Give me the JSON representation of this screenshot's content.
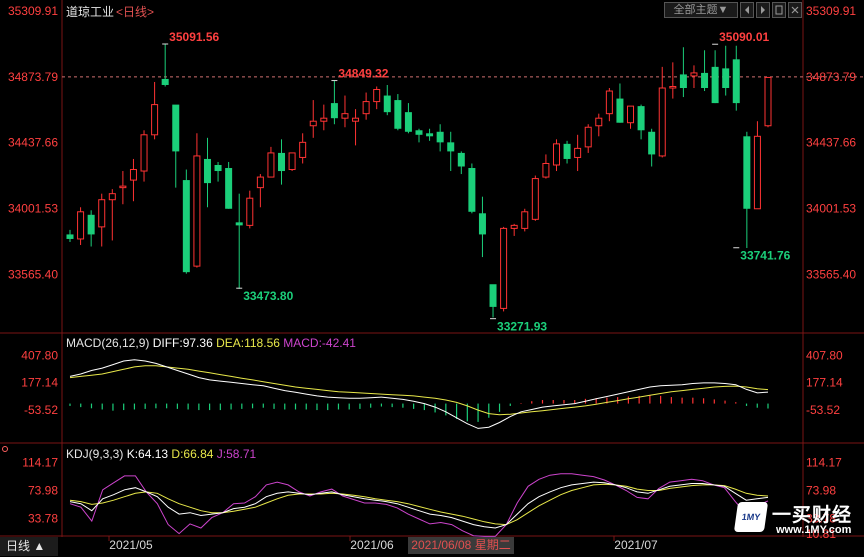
{
  "header": {
    "instrument": "道琼工业",
    "period": "<日线>",
    "theme_button": "全部主题",
    "theme_arrow": "▼"
  },
  "bottom_tab": "日线 ▲",
  "watermark": {
    "mark": "1MY",
    "name": "一买财经",
    "url": "www.1MY.com"
  },
  "colors": {
    "up": "#ff3333",
    "down": "#1bcf7a",
    "axis_red": "#ff4040",
    "diff": "#ffffff",
    "dea": "#e8e84a",
    "j": "#cc44cc",
    "grid": "#7a1515"
  },
  "chart_data": [
    {
      "type": "candlestick",
      "x_ticks": [
        "2021/05",
        "2021/06",
        "2021/07"
      ],
      "cursor_label": "2021/06/08 星期二",
      "y_ticks": [
        35309.91,
        34873.79,
        34437.66,
        34001.53,
        33565.4
      ],
      "ylim": [
        33230,
        35330
      ],
      "price_line": 34873.79,
      "annotations": [
        {
          "label": "35091.56",
          "value": 35091.56
        },
        {
          "label": "34849.32",
          "value": 34849.32
        },
        {
          "label": "33473.80",
          "value": 33473.8
        },
        {
          "label": "33271.93",
          "value": 33271.93
        },
        {
          "label": "35090.01",
          "value": 35090.01
        },
        {
          "label": "33741.76",
          "value": 33741.76
        }
      ],
      "candles": [
        [
          33830,
          33800,
          33860,
          33780
        ],
        [
          33800,
          33980,
          34010,
          33760
        ],
        [
          33960,
          33830,
          33990,
          33750
        ],
        [
          33880,
          34060,
          34100,
          33750
        ],
        [
          34060,
          34100,
          34130,
          33790
        ],
        [
          34140,
          34150,
          34250,
          34030
        ],
        [
          34190,
          34260,
          34330,
          34050
        ],
        [
          34250,
          34490,
          34520,
          34180
        ],
        [
          34490,
          34690,
          34840,
          34460
        ],
        [
          34860,
          34820,
          35090,
          34810
        ],
        [
          34690,
          34380,
          34410,
          34140
        ],
        [
          34190,
          33580,
          34260,
          33570
        ],
        [
          33620,
          34350,
          34500,
          33610
        ],
        [
          34330,
          34170,
          34470,
          34010
        ],
        [
          34290,
          34250,
          34310,
          34180
        ],
        [
          34270,
          34000,
          34310,
          34000
        ],
        [
          33910,
          33890,
          34100,
          33470
        ],
        [
          33890,
          34070,
          34120,
          33870
        ],
        [
          34140,
          34210,
          34230,
          34010
        ],
        [
          34210,
          34370,
          34410,
          34210
        ],
        [
          34370,
          34250,
          34460,
          34160
        ],
        [
          34260,
          34370,
          34360,
          34250
        ],
        [
          34340,
          34440,
          34500,
          34300
        ],
        [
          34550,
          34580,
          34720,
          34470
        ],
        [
          34580,
          34600,
          34690,
          34520
        ],
        [
          34700,
          34600,
          34850,
          34560
        ],
        [
          34600,
          34630,
          34750,
          34540
        ],
        [
          34580,
          34600,
          34660,
          34420
        ],
        [
          34630,
          34710,
          34770,
          34590
        ],
        [
          34710,
          34790,
          34810,
          34660
        ],
        [
          34750,
          34640,
          34820,
          34620
        ],
        [
          34720,
          34530,
          34760,
          34520
        ],
        [
          34640,
          34510,
          34700,
          34500
        ],
        [
          34520,
          34490,
          34530,
          34440
        ],
        [
          34500,
          34480,
          34530,
          34450
        ],
        [
          34510,
          34440,
          34560,
          34380
        ],
        [
          34440,
          34380,
          34510,
          34250
        ],
        [
          34370,
          34280,
          34380,
          34230
        ],
        [
          34270,
          33980,
          34300,
          33970
        ],
        [
          33970,
          33830,
          34080,
          33680
        ],
        [
          33500,
          33350,
          33400,
          33280
        ],
        [
          33340,
          33870,
          33880,
          33320
        ],
        [
          33870,
          33890,
          33900,
          33820
        ],
        [
          33870,
          33980,
          34000,
          33850
        ],
        [
          33930,
          34200,
          34220,
          33920
        ],
        [
          34210,
          34300,
          34360,
          34200
        ],
        [
          34290,
          34430,
          34460,
          34250
        ],
        [
          34430,
          34330,
          34450,
          34300
        ],
        [
          34340,
          34400,
          34490,
          34250
        ],
        [
          34410,
          34540,
          34560,
          34370
        ],
        [
          34550,
          34600,
          34630,
          34480
        ],
        [
          34630,
          34780,
          34800,
          34580
        ],
        [
          34730,
          34570,
          34830,
          34570
        ],
        [
          34570,
          34680,
          34680,
          34530
        ],
        [
          34680,
          34520,
          34690,
          34460
        ],
        [
          34510,
          34360,
          34530,
          34280
        ],
        [
          34350,
          34800,
          34940,
          34340
        ],
        [
          34800,
          34810,
          34970,
          34730
        ],
        [
          34890,
          34800,
          35070,
          34740
        ],
        [
          34880,
          34900,
          34950,
          34800
        ],
        [
          34900,
          34800,
          35050,
          34780
        ],
        [
          34940,
          34700,
          35050,
          34700
        ],
        [
          34930,
          34800,
          35080,
          34750
        ],
        [
          34990,
          34700,
          35080,
          34650
        ],
        [
          34480,
          34000,
          34510,
          33740
        ],
        [
          34000,
          34480,
          34580,
          34000
        ],
        [
          34550,
          34870,
          34870,
          34540
        ]
      ]
    },
    {
      "type": "line",
      "indicator": "MACD",
      "params": "(26,12,9)",
      "labels": {
        "name": "MACD(26,12,9)",
        "diff": "DIFF:97.36",
        "dea": "DEA:118.56",
        "macd": "MACD:-42.41"
      },
      "y_ticks": [
        407.8,
        177.14,
        -53.52
      ],
      "ylim": [
        -325,
        470
      ],
      "diff": [
        230,
        250,
        280,
        300,
        330,
        360,
        370,
        360,
        340,
        310,
        280,
        250,
        220,
        200,
        190,
        180,
        170,
        160,
        150,
        130,
        110,
        95,
        80,
        65,
        55,
        50,
        45,
        45,
        50,
        55,
        45,
        35,
        20,
        0,
        -30,
        -70,
        -120,
        -170,
        -210,
        -200,
        -160,
        -110,
        -70,
        -50,
        -30,
        -20,
        -10,
        0,
        20,
        40,
        60,
        80,
        100,
        120,
        140,
        150,
        155,
        160,
        170,
        175,
        175,
        170,
        160,
        120,
        90,
        97
      ],
      "dea": [
        220,
        230,
        240,
        250,
        270,
        290,
        310,
        320,
        320,
        310,
        300,
        290,
        275,
        260,
        245,
        230,
        215,
        200,
        185,
        170,
        155,
        140,
        130,
        120,
        110,
        100,
        95,
        90,
        85,
        80,
        75,
        70,
        65,
        55,
        45,
        30,
        10,
        -20,
        -55,
        -85,
        -95,
        -90,
        -80,
        -70,
        -60,
        -50,
        -40,
        -30,
        -20,
        -5,
        10,
        25,
        40,
        55,
        70,
        85,
        100,
        110,
        120,
        130,
        140,
        145,
        148,
        140,
        125,
        118
      ],
      "macd": [
        -20,
        -30,
        -40,
        -50,
        -60,
        -55,
        -50,
        -45,
        -40,
        -40,
        -45,
        -50,
        -55,
        -55,
        -55,
        -50,
        -45,
        -40,
        -35,
        -45,
        -50,
        -50,
        -50,
        -55,
        -55,
        -50,
        -50,
        -45,
        -35,
        -25,
        -30,
        -35,
        -45,
        -55,
        -75,
        -100,
        -130,
        -150,
        -155,
        -120,
        -70,
        -20,
        5,
        20,
        30,
        30,
        30,
        30,
        40,
        45,
        50,
        55,
        60,
        65,
        70,
        65,
        55,
        50,
        50,
        45,
        35,
        25,
        12,
        -20,
        -35,
        -42
      ]
    },
    {
      "type": "line",
      "indicator": "KDJ",
      "params": "(9,3,3)",
      "labels": {
        "name": "KDJ(9,3,3)",
        "k": "K:64.13",
        "d": "D:66.84",
        "j": "J:58.71"
      },
      "y_ticks": [
        114.17,
        73.98,
        33.78
      ],
      "bottom_tick": "10.81",
      "ylim": [
        10,
        125
      ],
      "k": [
        58,
        55,
        45,
        62,
        68,
        75,
        78,
        72,
        65,
        50,
        40,
        42,
        38,
        40,
        42,
        48,
        50,
        55,
        65,
        70,
        72,
        70,
        68,
        70,
        72,
        68,
        65,
        62,
        60,
        58,
        55,
        50,
        45,
        40,
        38,
        35,
        30,
        25,
        22,
        20,
        25,
        40,
        55,
        65,
        72,
        78,
        82,
        84,
        86,
        85,
        82,
        78,
        72,
        70,
        75,
        80,
        82,
        84,
        84,
        82,
        80,
        70,
        60,
        62,
        64
      ],
      "d": [
        60,
        58,
        54,
        56,
        60,
        65,
        70,
        72,
        70,
        62,
        55,
        50,
        45,
        42,
        42,
        44,
        47,
        50,
        56,
        62,
        67,
        69,
        69,
        69,
        70,
        69,
        67,
        65,
        62,
        60,
        58,
        55,
        51,
        47,
        43,
        40,
        37,
        33,
        29,
        26,
        25,
        32,
        42,
        52,
        60,
        68,
        74,
        78,
        82,
        83,
        82,
        80,
        76,
        74,
        74,
        77,
        79,
        81,
        82,
        82,
        81,
        76,
        70,
        67,
        66
      ],
      "j": [
        55,
        50,
        30,
        75,
        85,
        95,
        95,
        72,
        55,
        25,
        12,
        26,
        20,
        35,
        42,
        55,
        56,
        65,
        82,
        86,
        82,
        72,
        66,
        72,
        76,
        66,
        61,
        56,
        56,
        54,
        49,
        40,
        33,
        26,
        28,
        25,
        16,
        9,
        8,
        8,
        25,
        56,
        80,
        90,
        96,
        98,
        98,
        96,
        94,
        89,
        82,
        74,
        64,
        62,
        77,
        86,
        88,
        90,
        88,
        82,
        78,
        58,
        40,
        52,
        59
      ]
    }
  ]
}
